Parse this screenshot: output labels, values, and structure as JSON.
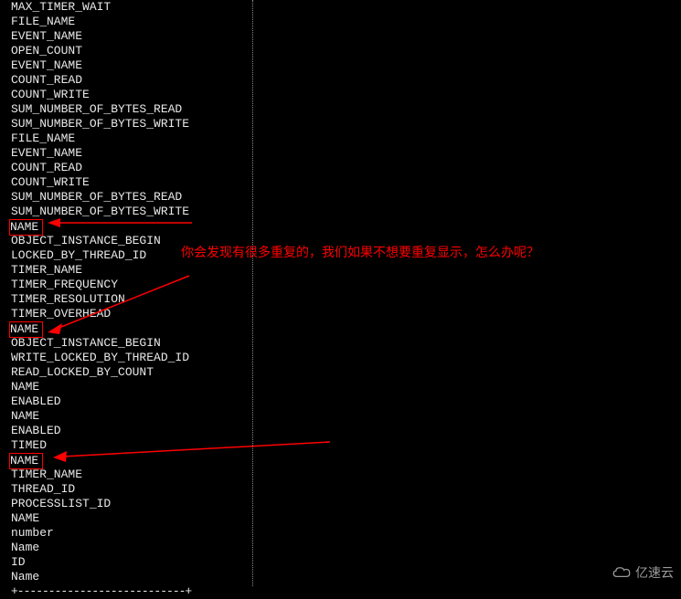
{
  "terminal": {
    "lines": [
      {
        "text": "MAX_TIMER_WAIT",
        "hl": false
      },
      {
        "text": "FILE_NAME",
        "hl": false
      },
      {
        "text": "EVENT_NAME",
        "hl": false
      },
      {
        "text": "OPEN_COUNT",
        "hl": false
      },
      {
        "text": "EVENT_NAME",
        "hl": false
      },
      {
        "text": "COUNT_READ",
        "hl": false
      },
      {
        "text": "COUNT_WRITE",
        "hl": false
      },
      {
        "text": "SUM_NUMBER_OF_BYTES_READ",
        "hl": false
      },
      {
        "text": "SUM_NUMBER_OF_BYTES_WRITE",
        "hl": false
      },
      {
        "text": "FILE_NAME",
        "hl": false
      },
      {
        "text": "EVENT_NAME",
        "hl": false
      },
      {
        "text": "COUNT_READ",
        "hl": false
      },
      {
        "text": "COUNT_WRITE",
        "hl": false
      },
      {
        "text": "SUM_NUMBER_OF_BYTES_READ",
        "hl": false
      },
      {
        "text": "SUM_NUMBER_OF_BYTES_WRITE",
        "hl": false
      },
      {
        "text": "NAME ",
        "hl": true
      },
      {
        "text": "OBJECT_INSTANCE_BEGIN",
        "hl": false
      },
      {
        "text": "LOCKED_BY_THREAD_ID",
        "hl": false
      },
      {
        "text": "TIMER_NAME",
        "hl": false
      },
      {
        "text": "TIMER_FREQUENCY",
        "hl": false
      },
      {
        "text": "TIMER_RESOLUTION",
        "hl": false
      },
      {
        "text": "TIMER_OVERHEAD",
        "hl": false
      },
      {
        "text": "NAME ",
        "hl": true
      },
      {
        "text": "OBJECT_INSTANCE_BEGIN",
        "hl": false
      },
      {
        "text": "WRITE_LOCKED_BY_THREAD_ID",
        "hl": false
      },
      {
        "text": "READ_LOCKED_BY_COUNT",
        "hl": false
      },
      {
        "text": "NAME",
        "hl": false
      },
      {
        "text": "ENABLED",
        "hl": false
      },
      {
        "text": "NAME",
        "hl": false
      },
      {
        "text": "ENABLED",
        "hl": false
      },
      {
        "text": "TIMED",
        "hl": false
      },
      {
        "text": "NAME ",
        "hl": true
      },
      {
        "text": "TIMER_NAME",
        "hl": false
      },
      {
        "text": "THREAD_ID",
        "hl": false
      },
      {
        "text": "PROCESSLIST_ID",
        "hl": false
      },
      {
        "text": "NAME",
        "hl": false
      },
      {
        "text": "number",
        "hl": false
      },
      {
        "text": "Name",
        "hl": false
      },
      {
        "text": "ID",
        "hl": false
      },
      {
        "text": "Name",
        "hl": false
      }
    ],
    "separator": "+---------------------------+"
  },
  "annotation": {
    "text": "你会发现有很多重复的，我们如果不想要重复显示，怎么办呢？"
  },
  "watermark": {
    "text": "亿速云"
  }
}
